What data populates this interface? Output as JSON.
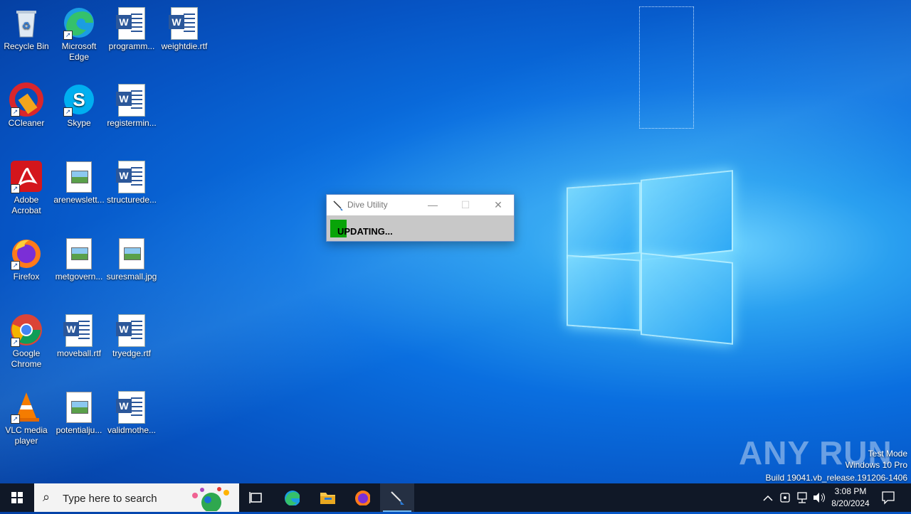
{
  "desktop": {
    "icons": [
      {
        "label": "Recycle Bin"
      },
      {
        "label": "Microsoft Edge"
      },
      {
        "label": "programm..."
      },
      {
        "label": "weightdie.rtf"
      },
      {
        "label": "CCleaner"
      },
      {
        "label": "Skype"
      },
      {
        "label": "registermin..."
      },
      {
        "label": "Adobe Acrobat"
      },
      {
        "label": "arenewslett..."
      },
      {
        "label": "structurede..."
      },
      {
        "label": "Firefox"
      },
      {
        "label": "metgovern..."
      },
      {
        "label": "suresmall.jpg"
      },
      {
        "label": "Google Chrome"
      },
      {
        "label": "moveball.rtf"
      },
      {
        "label": "tryedge.rtf"
      },
      {
        "label": "VLC media player"
      },
      {
        "label": "potentialju..."
      },
      {
        "label": "validmothe..."
      }
    ]
  },
  "dialog": {
    "title": "Dive Utility",
    "status": "UPDATING...",
    "minimize_glyph": "—",
    "maximize_glyph": "☐",
    "close_glyph": "✕"
  },
  "watermark": {
    "brand": "ANY RUN",
    "line1": "Test Mode",
    "line2": "Windows 10 Pro",
    "line3": "Build 19041.vb_release.191206-1406"
  },
  "taskbar": {
    "search_placeholder": "Type here to search",
    "time": "3:08 PM",
    "date": "8/20/2024",
    "pinned": [
      "task-view",
      "microsoft-edge",
      "file-explorer",
      "firefox",
      "dive-utility"
    ]
  },
  "colors": {
    "progress": "#08a408",
    "taskbar": "#101827",
    "accent": "#76b9ed"
  }
}
